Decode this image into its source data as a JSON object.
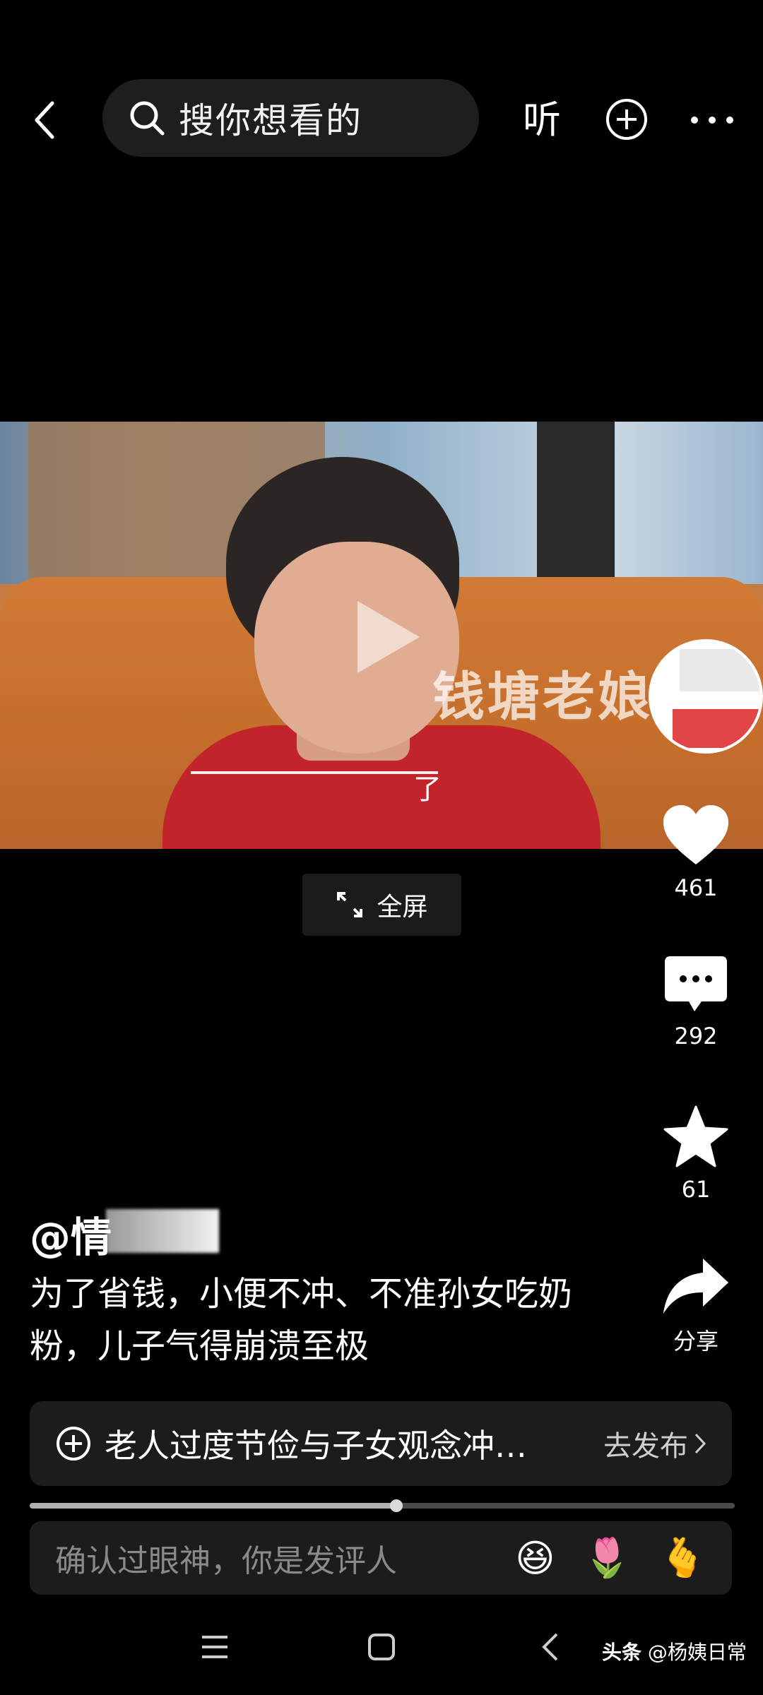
{
  "top_bar": {
    "search_placeholder": "搜你想看的",
    "listen_label": "听"
  },
  "video": {
    "watermark": "钱塘老娘",
    "subtitle_fragment": "了",
    "fullscreen_label": "全屏"
  },
  "actions": {
    "like_count": "461",
    "comment_count": "292",
    "favorite_count": "61",
    "share_label": "分享"
  },
  "post": {
    "author_handle": "@情",
    "caption": "为了省钱，小便不冲、不准孙女吃奶粉，儿子气得崩溃至极"
  },
  "topic": {
    "text": "老人过度节俭与子女观念冲…",
    "publish_label": "去发布"
  },
  "playback": {
    "progress_fraction": 0.52
  },
  "comment_box": {
    "placeholder": "确认过眼神，你是发评人",
    "emojis": [
      "😆",
      "🌷",
      "🫰"
    ]
  },
  "source_tag": {
    "app": "头条",
    "account": "@杨姨日常"
  }
}
